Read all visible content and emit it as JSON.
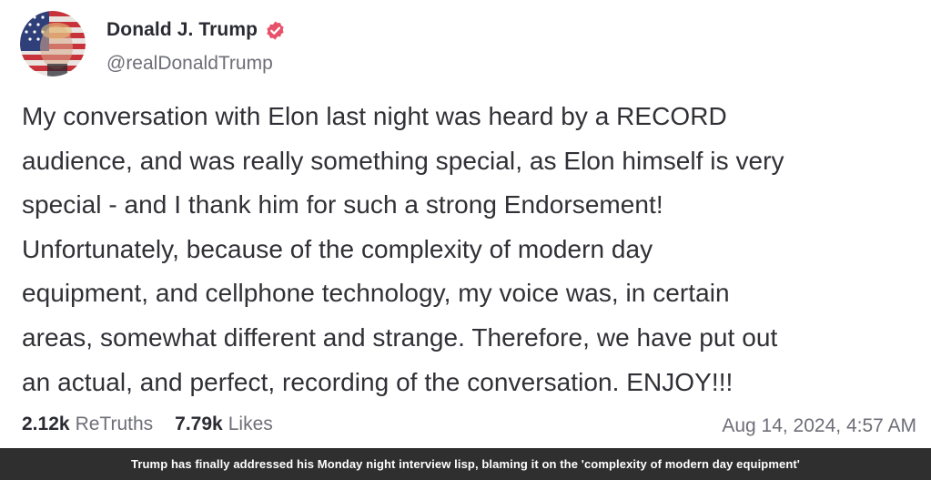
{
  "post": {
    "author": {
      "display_name": "Donald J. Trump",
      "handle": "@realDonaldTrump",
      "verified": true,
      "avatar_icon": "flag-portrait-avatar",
      "verified_icon": "verified-badge-icon"
    },
    "body_lines": [
      "My conversation with Elon last night was heard by a RECORD",
      "audience, and was really something special, as Elon himself is very",
      "special - and I thank him for such a strong Endorsement!",
      "Unfortunately, because of the complexity of modern day",
      "equipment, and cellphone technology, my voice was, in certain",
      "areas, somewhat different and strange. Therefore, we have put out",
      "an actual, and perfect, recording of the conversation. ENJOY!!!"
    ],
    "stats": {
      "retruths_count": "2.12k",
      "retruths_label": "ReTruths",
      "likes_count": "7.79k",
      "likes_label": "Likes"
    },
    "timestamp": "Aug 14, 2024, 4:57 AM"
  },
  "caption": "Trump has finally addressed his Monday night interview lisp, blaming it on the 'complexity of modern day equipment'",
  "colors": {
    "verified_badge": "#e8516a",
    "caption_bg": "#2f2f2f",
    "muted_text": "#6e6e78"
  }
}
